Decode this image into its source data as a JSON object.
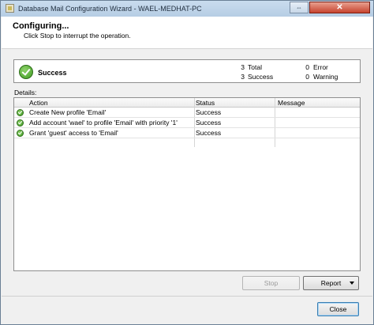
{
  "window": {
    "title": "Database Mail Configuration Wizard - WAEL-MEDHAT-PC",
    "maximize_glyph": "⇔",
    "close_glyph": "✕"
  },
  "header": {
    "title": "Configuring...",
    "subtitle": "Click Stop to interrupt the operation."
  },
  "summary": {
    "status": "Success",
    "stats": [
      {
        "count": "3",
        "label": "Total"
      },
      {
        "count": "3",
        "label": "Success"
      },
      {
        "count": "0",
        "label": "Error"
      },
      {
        "count": "0",
        "label": "Warning"
      }
    ]
  },
  "details": {
    "label": "Details:",
    "columns": [
      "Action",
      "Status",
      "Message"
    ],
    "rows": [
      {
        "action": "Create New profile 'Email'",
        "status": "Success",
        "message": ""
      },
      {
        "action": "Add account 'wael' to profile 'Email' with priority '1'",
        "status": "Success",
        "message": ""
      },
      {
        "action": "Grant 'guest' access to 'Email'",
        "status": "Success",
        "message": ""
      }
    ]
  },
  "buttons": {
    "stop": "Stop",
    "report": "Report",
    "close": "Close"
  },
  "colors": {
    "success_green": "#3f9b24",
    "title_bar": "#c9dcee",
    "close_red": "#c7442f"
  },
  "icons": {
    "status": "check-circle-icon",
    "window": "app-icon"
  }
}
